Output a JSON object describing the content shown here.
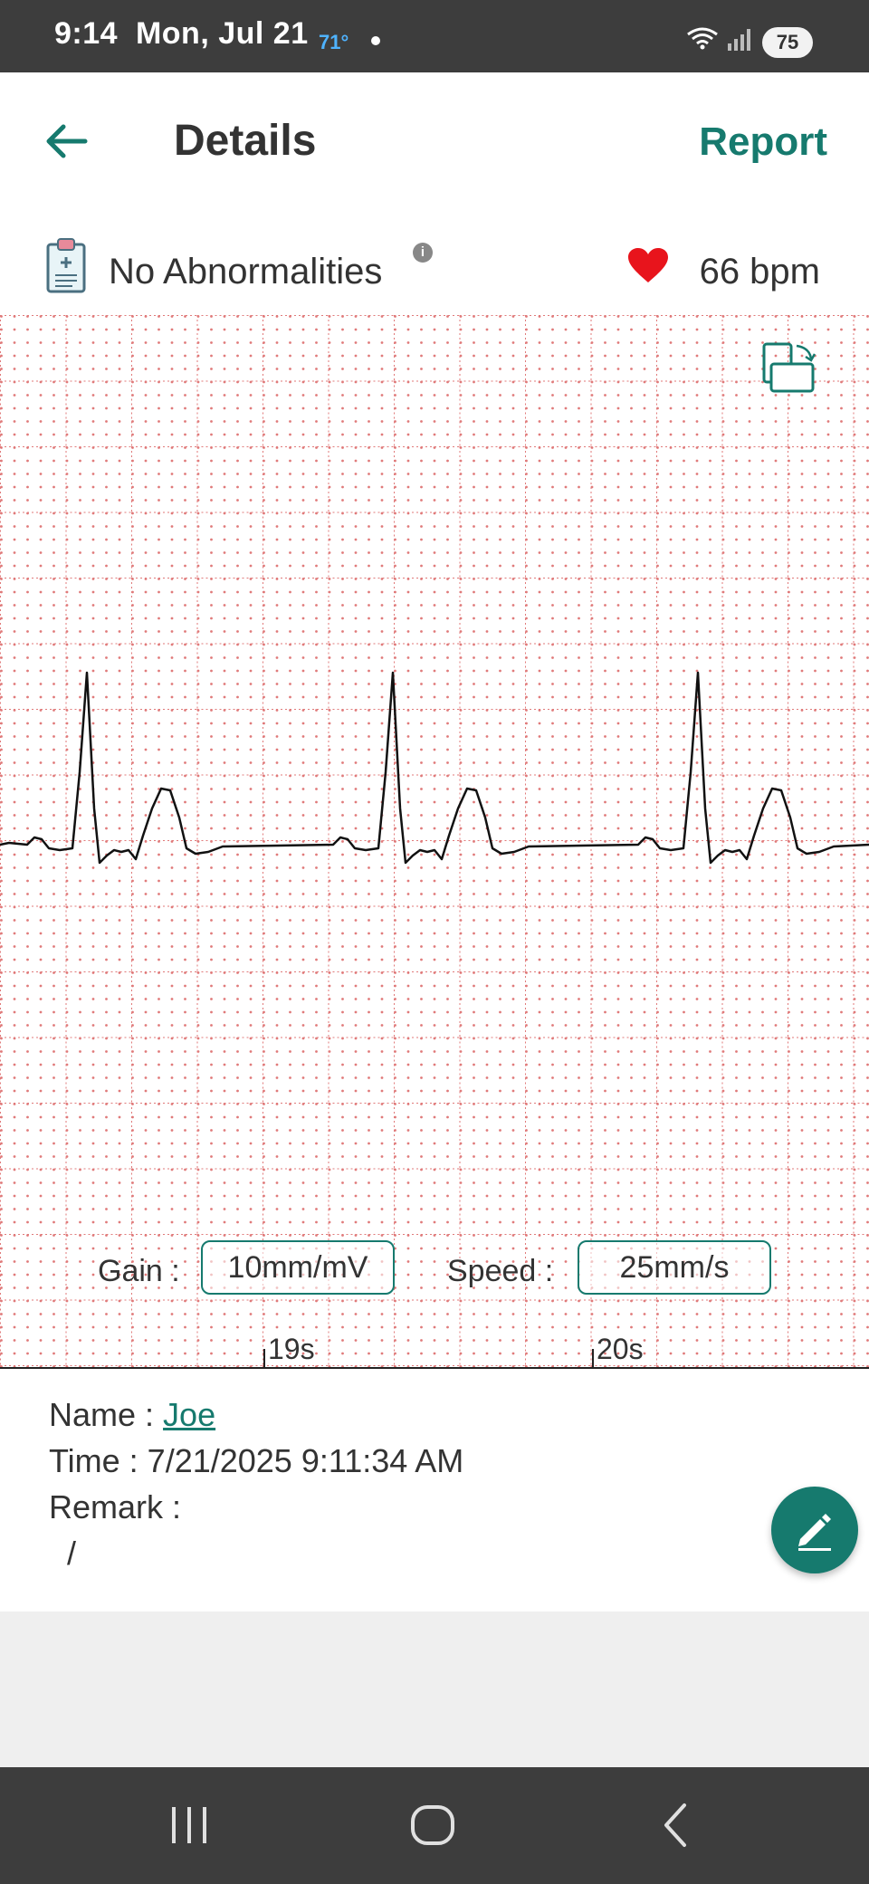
{
  "status_bar": {
    "time": "9:14",
    "date": "Mon, Jul 21",
    "weather": "71°",
    "battery": "75"
  },
  "app_bar": {
    "title": "Details",
    "report_label": "Report"
  },
  "summary": {
    "diagnosis": "No Abnormalities",
    "heart_rate": "66 bpm"
  },
  "ecg": {
    "gain_label": "Gain :",
    "gain_value": "10mm/mV",
    "speed_label": "Speed :",
    "speed_value": "25mm/s",
    "ticks": [
      {
        "label": "19s"
      },
      {
        "label": "20s"
      }
    ]
  },
  "details": {
    "name_label": "Name : ",
    "name_value": "Joe",
    "time_line": "Time : 7/21/2025  9:11:34 AM",
    "remark_label": "Remark :",
    "remark_value": "/"
  },
  "colors": {
    "accent": "#167a6e",
    "grid": "#e07a7a",
    "heart": "#e8141c"
  }
}
